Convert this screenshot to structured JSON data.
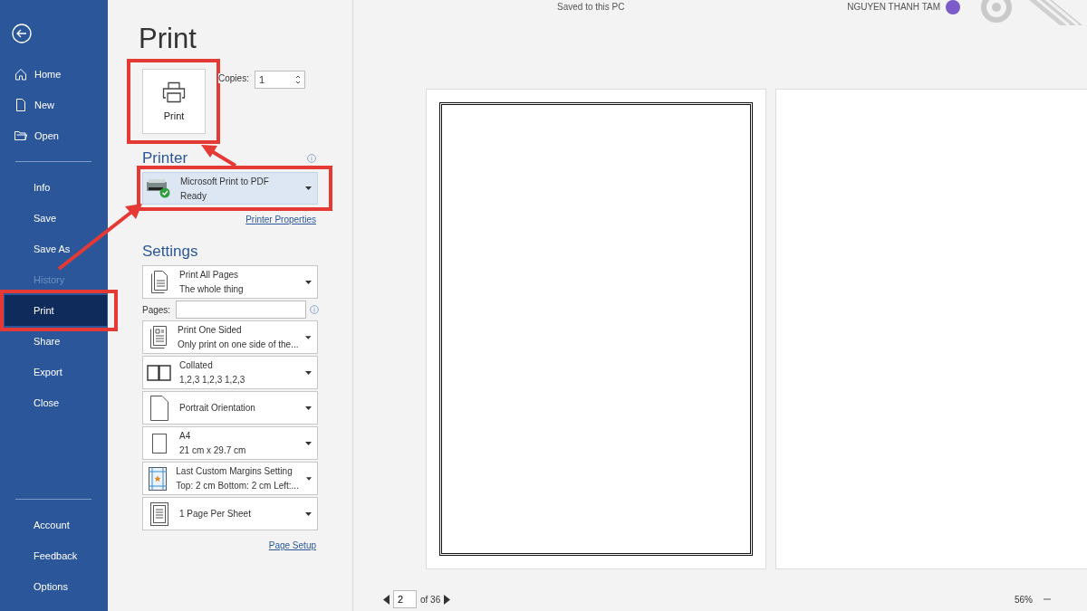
{
  "title_bar": {
    "status": "Saved to this PC",
    "user": "NGUYEN THANH TAM"
  },
  "nav_primary": [
    {
      "kind": "home",
      "label": "Home"
    },
    {
      "kind": "new",
      "label": "New"
    },
    {
      "kind": "open",
      "label": "Open"
    }
  ],
  "nav_secondary": [
    {
      "label": "Info",
      "selected": false,
      "disabled": false,
      "highlighted": false
    },
    {
      "label": "Save",
      "selected": false,
      "disabled": false,
      "highlighted": false
    },
    {
      "label": "Save As",
      "selected": false,
      "disabled": false,
      "highlighted": false
    },
    {
      "label": "History",
      "selected": false,
      "disabled": true,
      "highlighted": false
    },
    {
      "label": "Print",
      "selected": true,
      "disabled": false,
      "highlighted": true
    },
    {
      "label": "Share",
      "selected": false,
      "disabled": false,
      "highlighted": false
    },
    {
      "label": "Export",
      "selected": false,
      "disabled": false,
      "highlighted": false
    },
    {
      "label": "Close",
      "selected": false,
      "disabled": false,
      "highlighted": false
    }
  ],
  "nav_footer": [
    {
      "label": "Account"
    },
    {
      "label": "Feedback"
    },
    {
      "label": "Options"
    }
  ],
  "title": "Print",
  "print_button": {
    "label": "Print",
    "highlighted": true
  },
  "copies": {
    "label": "Copies:",
    "value": "1"
  },
  "printer": {
    "heading": "Printer",
    "name": "Microsoft Print to PDF",
    "status": "Ready",
    "highlighted": true,
    "properties_link": "Printer Properties"
  },
  "settings": {
    "heading": "Settings",
    "page_setup_link": "Page Setup",
    "items": [
      {
        "kind": "document",
        "title": "Print All Pages",
        "subtitle": "The whole thing"
      },
      {
        "kind": "pages-field",
        "label": "Pages:"
      },
      {
        "kind": "one-sided",
        "title": "Print One Sided",
        "subtitle": "Only print on one side of the..."
      },
      {
        "kind": "collated",
        "title": "Collated",
        "subtitle": "1,2,3 1,2,3 1,2,3"
      },
      {
        "kind": "portrait",
        "title": "Portrait Orientation"
      },
      {
        "kind": "paper",
        "title": "A4",
        "subtitle": "21 cm x 29.7 cm"
      },
      {
        "kind": "margins",
        "title": "Last Custom Margins Setting",
        "subtitle": "Top: 2 cm Bottom: 2 cm Left:..."
      },
      {
        "kind": "per-sheet",
        "title": "1 Page Per Sheet"
      }
    ]
  },
  "preview": {
    "page": "2",
    "of": "of 36",
    "zoom": "56%"
  }
}
